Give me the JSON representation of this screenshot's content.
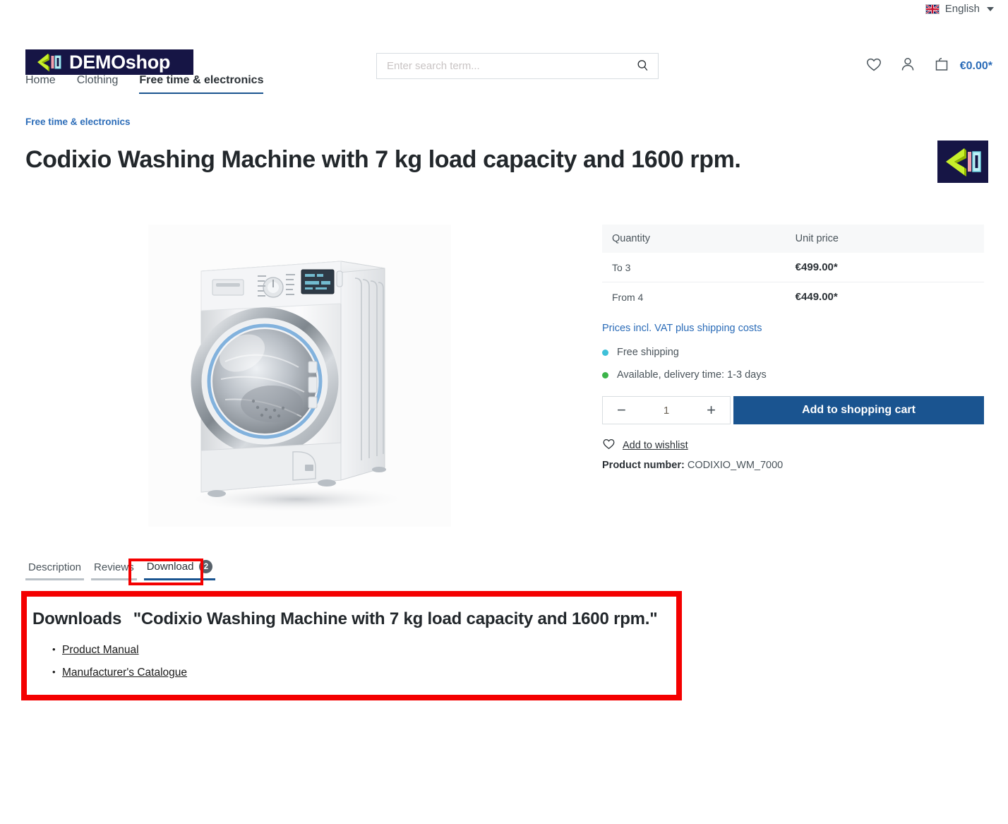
{
  "topbar": {
    "flag_icon": "uk-flag-icon",
    "language": "English",
    "caret_icon": "chevron-down-icon"
  },
  "header": {
    "logo_text": "DEMOshop",
    "logo_mark_icon": "demoshop-chevron-logo",
    "search": {
      "placeholder": "Enter search term...",
      "value": "",
      "icon": "search-icon"
    },
    "actions": {
      "wishlist_icon": "heart-icon",
      "account_icon": "person-icon",
      "cart_icon": "shopping-bag-icon",
      "cart_total": "€0.00*"
    }
  },
  "nav": {
    "items": [
      {
        "label": "Home",
        "active": false
      },
      {
        "label": "Clothing",
        "active": false
      },
      {
        "label": "Free time & electronics",
        "active": true
      }
    ]
  },
  "product": {
    "breadcrumb": "Free time & electronics",
    "title": "Codixio Washing Machine with 7 kg load capacity and 1600 rpm.",
    "brand_badge_icon": "codixio-brand-logo",
    "image_alt": "washing-machine-product-photo"
  },
  "pricing": {
    "headers": {
      "quantity": "Quantity",
      "unit_price": "Unit price"
    },
    "rows": [
      {
        "quantity": "To 3",
        "unit_price": "€499.00*"
      },
      {
        "quantity": "From 4",
        "unit_price": "€449.00*"
      }
    ],
    "vat_note": "Prices incl. VAT plus shipping costs"
  },
  "availability": {
    "shipping": {
      "label": "Free shipping",
      "color": "#3ec0d8"
    },
    "stock": {
      "label": "Available, delivery time: 1-3 days",
      "color": "#3cb44a"
    }
  },
  "purchase": {
    "decrease_label": "−",
    "increase_label": "+",
    "quantity": "1",
    "add_to_cart": "Add to shopping cart",
    "add_to_cart_color": "#1a5490",
    "wishlist_icon": "heart-icon",
    "wishlist_label": "Add to wishlist",
    "product_number_label": "Product number:",
    "product_number_value": "CODIXIO_WM_7000"
  },
  "tabs": {
    "items": [
      {
        "label": "Description",
        "active": false,
        "badge": ""
      },
      {
        "label": "Reviews",
        "active": false,
        "badge": ""
      },
      {
        "label": "Download",
        "active": true,
        "badge": "2"
      }
    ]
  },
  "downloads": {
    "heading": "Downloads",
    "title": "\"Codixio Washing Machine with 7 kg load capacity and 1600 rpm.\"",
    "links": [
      {
        "label": "Product Manual"
      },
      {
        "label": "Manufacturer's Catalogue"
      }
    ],
    "highlight_color": "#f40000"
  }
}
